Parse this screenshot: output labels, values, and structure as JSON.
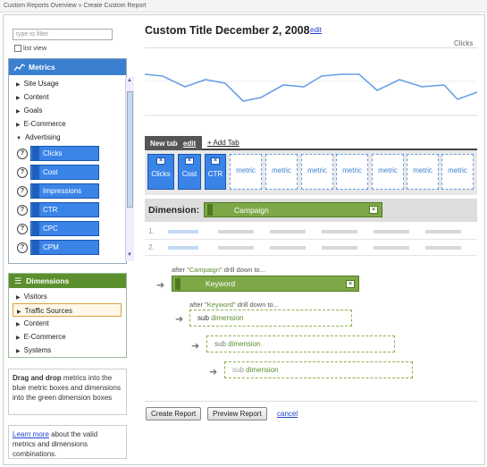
{
  "breadcrumb": "Custom Reports Overview » Create Custom Report",
  "sidebar": {
    "filter_placeholder": "type to filter",
    "list_view_label": "list view",
    "metrics_title": "Metrics",
    "metric_groups": [
      "Site Usage",
      "Content",
      "Goals",
      "E-Commerce",
      "Advertising"
    ],
    "advertising_metrics": [
      "Clicks",
      "Cost",
      "Impressions",
      "CTR",
      "CPC",
      "CPM"
    ],
    "dimensions_title": "Dimensions",
    "dimension_groups": [
      "Visitors",
      "Traffic Sources",
      "Content",
      "E-Commerce",
      "Systems"
    ],
    "help_text": "Drag and drop metrics into the blue metric boxes and dimensions into the green dimension boxes",
    "help_text_bold": "Drag and drop",
    "learn_more_link": "Learn more",
    "learn_more_text": " about the valid metrics and dimensions combinations."
  },
  "main": {
    "title": "Custom Title December 2, 2008",
    "title_edit": "edit",
    "chart_metric_label": "Clicks",
    "tab_label": "New tab",
    "tab_edit": "edit",
    "add_tab": "+ Add Tab",
    "filled_metrics": [
      "Clicks",
      "Cost",
      "CTR"
    ],
    "empty_metric_label": "metric",
    "dimension_label": "Dimension:",
    "primary_dimension": "Campaign",
    "row_numbers": [
      "1.",
      "2."
    ],
    "drilldowns": [
      {
        "prefix": "after \"",
        "name": "Campaign",
        "suffix": "\" drill down to...",
        "pill": "Keyword"
      },
      {
        "prefix": "after \"",
        "name": "Keyword",
        "suffix": "\" drill down to...",
        "pill": ""
      }
    ],
    "sub_dimension_prefix": "sub ",
    "sub_dimension_word": "dimension",
    "create_button": "Create Report",
    "preview_button": "Preview Report",
    "cancel_link": "cancel"
  },
  "colors": {
    "metric_blue": "#3a84e8",
    "dimension_green": "#7ea848",
    "link": "#2244cc"
  }
}
